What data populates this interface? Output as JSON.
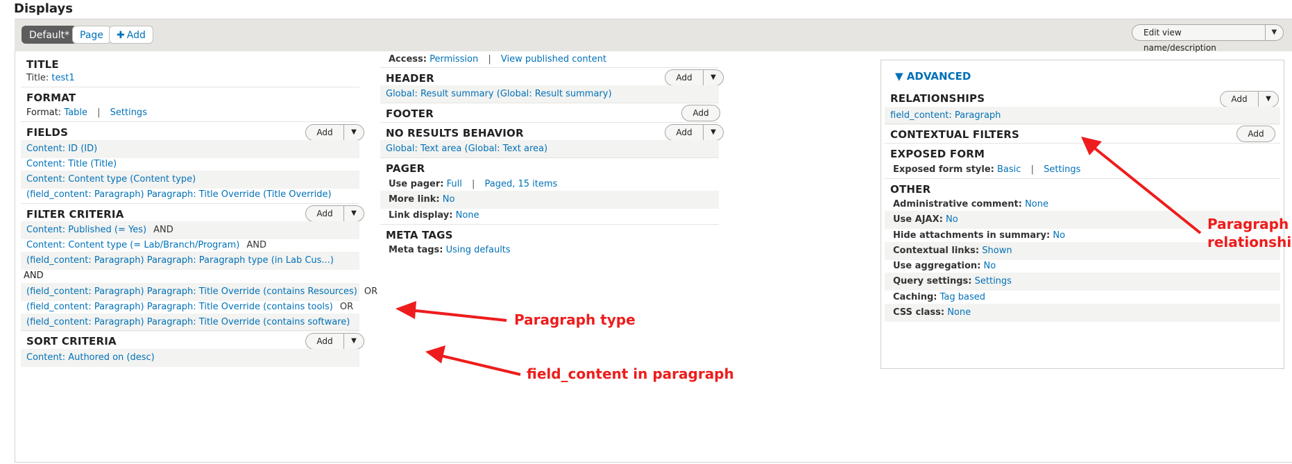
{
  "page": {
    "heading": "Displays"
  },
  "display_tabs": {
    "default": "Default*",
    "page": "Page",
    "add": "Add",
    "edit_view": "Edit view name/description"
  },
  "icons": {
    "dropdown": "caret-down-icon",
    "add": "plus-icon",
    "advanced_toggle": "triangle-down-icon"
  },
  "colors": {
    "link": "#0071b8",
    "annotation": "#ee1c1c",
    "active_tab": "#5d5d5d"
  },
  "left": {
    "title": {
      "heading": "TITLE",
      "label": "Title:",
      "value": "test1"
    },
    "format": {
      "heading": "FORMAT",
      "label": "Format:",
      "value": "Table",
      "sep": "|",
      "settings": "Settings"
    },
    "fields": {
      "heading": "FIELDS",
      "add": "Add",
      "items": [
        "Content: ID (ID)",
        "Content: Title (Title)",
        "Content: Content type (Content type)",
        "(field_content: Paragraph) Paragraph: Title Override (Title Override)"
      ]
    },
    "filters": {
      "heading": "FILTER CRITERIA",
      "add": "Add",
      "items": [
        {
          "text": "Content: Published (= Yes)",
          "conj": "AND"
        },
        {
          "text": "Content: Content type (= Lab/Branch/Program)",
          "conj": "AND"
        },
        {
          "text": "(field_content: Paragraph) Paragraph: Paragraph type (in Lab Cus...)",
          "conj": ""
        }
      ],
      "group_op": "AND",
      "group_items": [
        {
          "text": "(field_content: Paragraph) Paragraph: Title Override (contains Resources)",
          "conj": "OR"
        },
        {
          "text": "(field_content: Paragraph) Paragraph: Title Override (contains tools)",
          "conj": "OR"
        },
        {
          "text": "(field_content: Paragraph) Paragraph: Title Override (contains software)",
          "conj": ""
        }
      ]
    },
    "sort": {
      "heading": "SORT CRITERIA",
      "add": "Add",
      "items": [
        "Content: Authored on (desc)"
      ]
    }
  },
  "middle": {
    "access": {
      "label": "Access:",
      "value": "Permission",
      "sep": "|",
      "detail": "View published content"
    },
    "header": {
      "heading": "HEADER",
      "add": "Add",
      "item": "Global: Result summary (Global: Result summary)"
    },
    "footer": {
      "heading": "FOOTER",
      "add": "Add"
    },
    "no_results": {
      "heading": "NO RESULTS BEHAVIOR",
      "add": "Add",
      "item": "Global: Text area (Global: Text area)"
    },
    "pager": {
      "heading": "PAGER",
      "use_pager_label": "Use pager:",
      "use_pager_value": "Full",
      "sep": "|",
      "use_pager_detail": "Paged, 15 items",
      "more_link_label": "More link:",
      "more_link_value": "No",
      "link_display_label": "Link display:",
      "link_display_value": "None"
    },
    "meta": {
      "heading": "META TAGS",
      "label": "Meta tags:",
      "value": "Using defaults"
    }
  },
  "advanced": {
    "toggle": "ADVANCED",
    "relationships": {
      "heading": "RELATIONSHIPS",
      "add": "Add",
      "item": "field_content: Paragraph"
    },
    "contextual": {
      "heading": "CONTEXTUAL FILTERS",
      "add": "Add"
    },
    "exposed": {
      "heading": "EXPOSED FORM",
      "label": "Exposed form style:",
      "value": "Basic",
      "sep": "|",
      "settings": "Settings"
    },
    "other": {
      "heading": "OTHER",
      "rows": [
        {
          "label": "Administrative comment:",
          "value": "None"
        },
        {
          "label": "Use AJAX:",
          "value": "No"
        },
        {
          "label": "Hide attachments in summary:",
          "value": "No"
        },
        {
          "label": "Contextual links:",
          "value": "Shown"
        },
        {
          "label": "Use aggregation:",
          "value": "No"
        },
        {
          "label": "Query settings:",
          "value": "Settings"
        },
        {
          "label": "Caching:",
          "value": "Tag based"
        },
        {
          "label": "CSS class:",
          "value": "None"
        }
      ]
    }
  },
  "annotations": {
    "paragraph_type": "Paragraph type",
    "field_content": "field_content in paragraph",
    "relationship_line1": "Paragraph",
    "relationship_line2": "relationship"
  }
}
